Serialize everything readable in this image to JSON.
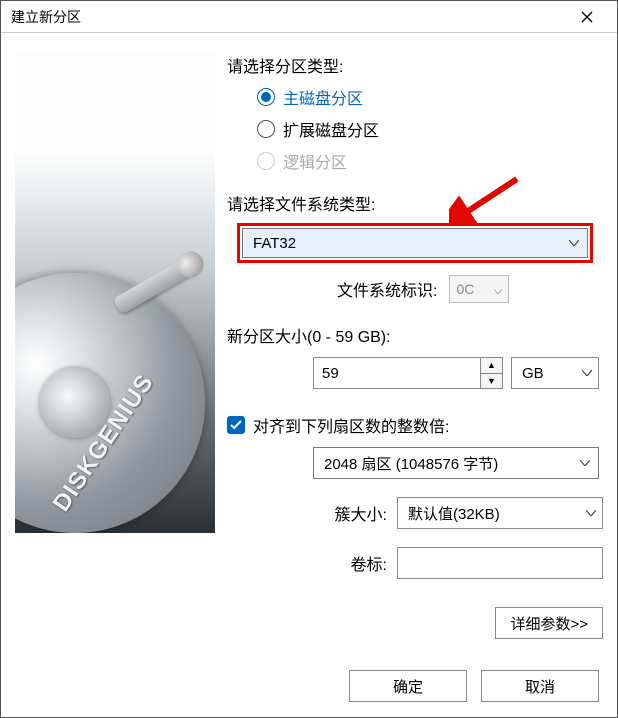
{
  "window": {
    "title": "建立新分区"
  },
  "brand": "DISKGENIUS",
  "partition_type": {
    "label": "请选择分区类型:",
    "options": {
      "primary": "主磁盘分区",
      "extended": "扩展磁盘分区",
      "logical": "逻辑分区"
    }
  },
  "filesystem": {
    "label": "请选择文件系统类型:",
    "value": "FAT32",
    "id_label": "文件系统标识:",
    "id_value": "0C"
  },
  "size": {
    "label": "新分区大小(0 - 59 GB):",
    "value": "59",
    "unit": "GB"
  },
  "align": {
    "checkbox_label": "对齐到下列扇区数的整数倍:",
    "value": "2048 扇区 (1048576 字节)"
  },
  "cluster": {
    "label": "簇大小:",
    "value": "默认值(32KB)"
  },
  "volume_label": {
    "label": "卷标:",
    "value": ""
  },
  "buttons": {
    "detail": "详细参数>>",
    "ok": "确定",
    "cancel": "取消"
  }
}
